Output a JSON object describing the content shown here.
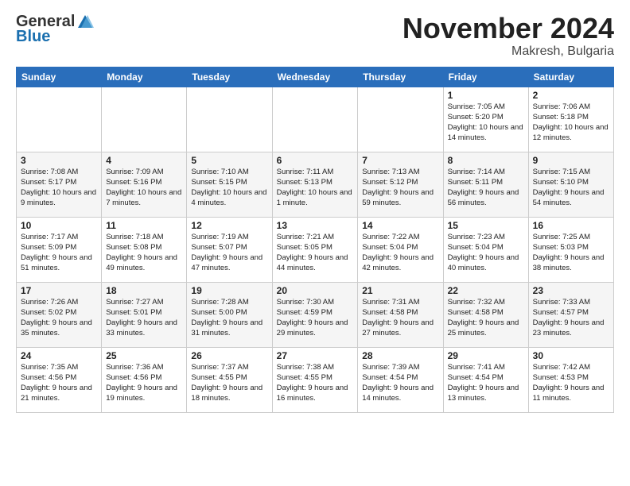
{
  "logo": {
    "general": "General",
    "blue": "Blue"
  },
  "header": {
    "month": "November 2024",
    "location": "Makresh, Bulgaria"
  },
  "weekdays": [
    "Sunday",
    "Monday",
    "Tuesday",
    "Wednesday",
    "Thursday",
    "Friday",
    "Saturday"
  ],
  "weeks": [
    [
      {
        "day": "",
        "info": ""
      },
      {
        "day": "",
        "info": ""
      },
      {
        "day": "",
        "info": ""
      },
      {
        "day": "",
        "info": ""
      },
      {
        "day": "",
        "info": ""
      },
      {
        "day": "1",
        "info": "Sunrise: 7:05 AM\nSunset: 5:20 PM\nDaylight: 10 hours and 14 minutes."
      },
      {
        "day": "2",
        "info": "Sunrise: 7:06 AM\nSunset: 5:18 PM\nDaylight: 10 hours and 12 minutes."
      }
    ],
    [
      {
        "day": "3",
        "info": "Sunrise: 7:08 AM\nSunset: 5:17 PM\nDaylight: 10 hours and 9 minutes."
      },
      {
        "day": "4",
        "info": "Sunrise: 7:09 AM\nSunset: 5:16 PM\nDaylight: 10 hours and 7 minutes."
      },
      {
        "day": "5",
        "info": "Sunrise: 7:10 AM\nSunset: 5:15 PM\nDaylight: 10 hours and 4 minutes."
      },
      {
        "day": "6",
        "info": "Sunrise: 7:11 AM\nSunset: 5:13 PM\nDaylight: 10 hours and 1 minute."
      },
      {
        "day": "7",
        "info": "Sunrise: 7:13 AM\nSunset: 5:12 PM\nDaylight: 9 hours and 59 minutes."
      },
      {
        "day": "8",
        "info": "Sunrise: 7:14 AM\nSunset: 5:11 PM\nDaylight: 9 hours and 56 minutes."
      },
      {
        "day": "9",
        "info": "Sunrise: 7:15 AM\nSunset: 5:10 PM\nDaylight: 9 hours and 54 minutes."
      }
    ],
    [
      {
        "day": "10",
        "info": "Sunrise: 7:17 AM\nSunset: 5:09 PM\nDaylight: 9 hours and 51 minutes."
      },
      {
        "day": "11",
        "info": "Sunrise: 7:18 AM\nSunset: 5:08 PM\nDaylight: 9 hours and 49 minutes."
      },
      {
        "day": "12",
        "info": "Sunrise: 7:19 AM\nSunset: 5:07 PM\nDaylight: 9 hours and 47 minutes."
      },
      {
        "day": "13",
        "info": "Sunrise: 7:21 AM\nSunset: 5:05 PM\nDaylight: 9 hours and 44 minutes."
      },
      {
        "day": "14",
        "info": "Sunrise: 7:22 AM\nSunset: 5:04 PM\nDaylight: 9 hours and 42 minutes."
      },
      {
        "day": "15",
        "info": "Sunrise: 7:23 AM\nSunset: 5:04 PM\nDaylight: 9 hours and 40 minutes."
      },
      {
        "day": "16",
        "info": "Sunrise: 7:25 AM\nSunset: 5:03 PM\nDaylight: 9 hours and 38 minutes."
      }
    ],
    [
      {
        "day": "17",
        "info": "Sunrise: 7:26 AM\nSunset: 5:02 PM\nDaylight: 9 hours and 35 minutes."
      },
      {
        "day": "18",
        "info": "Sunrise: 7:27 AM\nSunset: 5:01 PM\nDaylight: 9 hours and 33 minutes."
      },
      {
        "day": "19",
        "info": "Sunrise: 7:28 AM\nSunset: 5:00 PM\nDaylight: 9 hours and 31 minutes."
      },
      {
        "day": "20",
        "info": "Sunrise: 7:30 AM\nSunset: 4:59 PM\nDaylight: 9 hours and 29 minutes."
      },
      {
        "day": "21",
        "info": "Sunrise: 7:31 AM\nSunset: 4:58 PM\nDaylight: 9 hours and 27 minutes."
      },
      {
        "day": "22",
        "info": "Sunrise: 7:32 AM\nSunset: 4:58 PM\nDaylight: 9 hours and 25 minutes."
      },
      {
        "day": "23",
        "info": "Sunrise: 7:33 AM\nSunset: 4:57 PM\nDaylight: 9 hours and 23 minutes."
      }
    ],
    [
      {
        "day": "24",
        "info": "Sunrise: 7:35 AM\nSunset: 4:56 PM\nDaylight: 9 hours and 21 minutes."
      },
      {
        "day": "25",
        "info": "Sunrise: 7:36 AM\nSunset: 4:56 PM\nDaylight: 9 hours and 19 minutes."
      },
      {
        "day": "26",
        "info": "Sunrise: 7:37 AM\nSunset: 4:55 PM\nDaylight: 9 hours and 18 minutes."
      },
      {
        "day": "27",
        "info": "Sunrise: 7:38 AM\nSunset: 4:55 PM\nDaylight: 9 hours and 16 minutes."
      },
      {
        "day": "28",
        "info": "Sunrise: 7:39 AM\nSunset: 4:54 PM\nDaylight: 9 hours and 14 minutes."
      },
      {
        "day": "29",
        "info": "Sunrise: 7:41 AM\nSunset: 4:54 PM\nDaylight: 9 hours and 13 minutes."
      },
      {
        "day": "30",
        "info": "Sunrise: 7:42 AM\nSunset: 4:53 PM\nDaylight: 9 hours and 11 minutes."
      }
    ]
  ]
}
